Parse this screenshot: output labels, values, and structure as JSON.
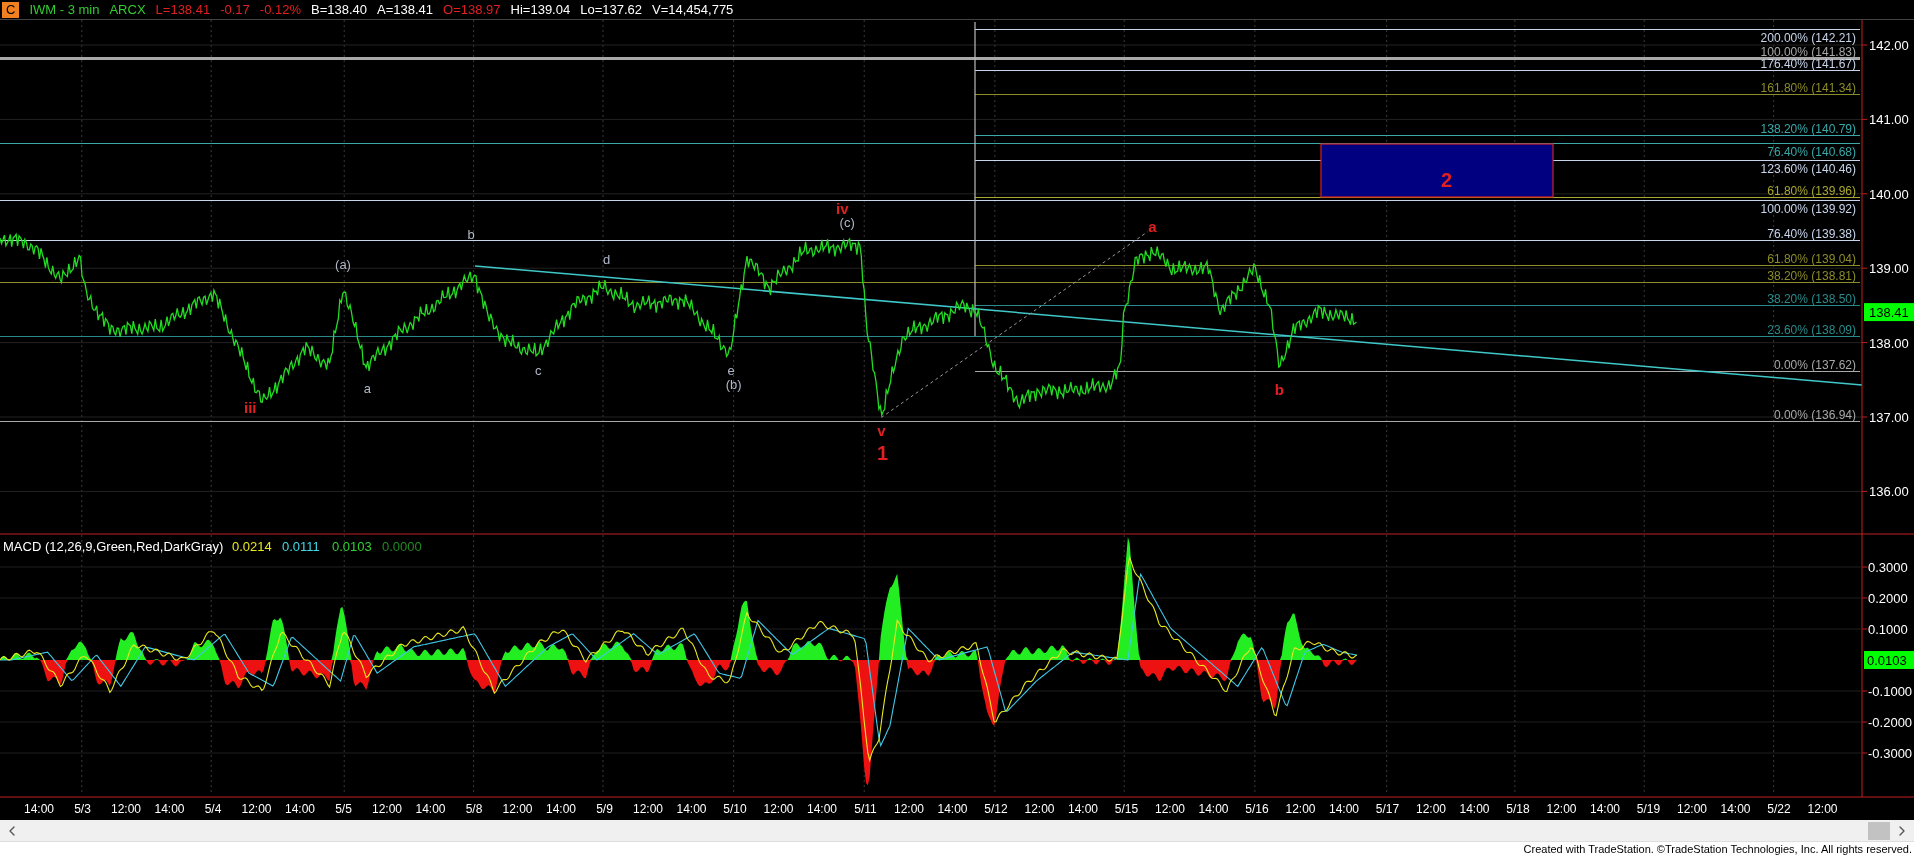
{
  "header": {
    "badge": "C",
    "items": [
      {
        "text": "IWM - 3 min",
        "color": "#33cc33"
      },
      {
        "text": "ARCX",
        "color": "#33cc33"
      },
      {
        "text": "L=138.41",
        "color": "#e02020"
      },
      {
        "text": "-0.17",
        "color": "#e02020"
      },
      {
        "text": "-0.12%",
        "color": "#e02020"
      },
      {
        "text": "B=138.40",
        "color": "#ffffff"
      },
      {
        "text": "A=138.41",
        "color": "#ffffff"
      },
      {
        "text": "O=138.97",
        "color": "#e02020"
      },
      {
        "text": "Hi=139.04",
        "color": "#ffffff"
      },
      {
        "text": "Lo=137.62",
        "color": "#ffffff"
      },
      {
        "text": "V=14,454,775",
        "color": "#ffffff"
      }
    ]
  },
  "price_axis": {
    "labels": [
      "142.00",
      "141.00",
      "140.00",
      "139.00",
      "138.00",
      "137.00",
      "136.00"
    ],
    "last_price": "138.41"
  },
  "fib_levels": [
    {
      "label": "200.00% (142.21)",
      "color": "#c8d4ea",
      "from_start": false
    },
    {
      "label": "100.00% (141.83)",
      "color": "#a8a8a8",
      "from_start": true
    },
    {
      "label": "176.40% (141.67)",
      "color": "#c8d4ea",
      "from_start": false
    },
    {
      "label": "161.80% (141.34)",
      "color": "#8c8c2a",
      "from_start": false
    },
    {
      "label": "138.20% (140.79)",
      "color": "#38a8a8",
      "from_start": false
    },
    {
      "label": "76.40% (140.68)",
      "color": "#38a8a8",
      "from_start": true
    },
    {
      "label": "123.60% (140.46)",
      "color": "#c8d4ea",
      "from_start": false
    },
    {
      "label": "61.80% (139.96)",
      "color": "#a8a830",
      "from_start": false
    },
    {
      "label": "100.00% (139.92)",
      "color": "#c8d4ea",
      "from_start": true
    },
    {
      "label": "76.40% (139.38)",
      "color": "#c8d4ea",
      "from_start": true
    },
    {
      "label": "61.80% (139.04)",
      "color": "#8c8c2a",
      "from_start": false
    },
    {
      "label": "38.20% (138.81)",
      "color": "#8c8c2a",
      "from_start": true
    },
    {
      "label": "38.20% (138.50)",
      "color": "#2a8a8a",
      "from_start": false
    },
    {
      "label": "23.60% (138.09)",
      "color": "#2a8a8a",
      "from_start": true
    },
    {
      "label": "0.00% (137.62)",
      "color": "#a8a8a8",
      "from_start": false
    },
    {
      "label": "0.00% (136.94)",
      "color": "#a8a8a8",
      "from_start": true
    }
  ],
  "wave_labels": [
    {
      "text": "iii",
      "color": "#e02020",
      "kind": "minor"
    },
    {
      "text": "(a)",
      "color": "#b0b8c8",
      "kind": "minor"
    },
    {
      "text": "a",
      "color": "#b0b8c8",
      "kind": "minor"
    },
    {
      "text": "b",
      "color": "#b0b8c8",
      "kind": "minor"
    },
    {
      "text": "c",
      "color": "#b0b8c8",
      "kind": "minor"
    },
    {
      "text": "d",
      "color": "#b0b8c8",
      "kind": "minor"
    },
    {
      "text": "e",
      "color": "#b0b8c8",
      "kind": "minor"
    },
    {
      "text": "(b)",
      "color": "#b0b8c8",
      "kind": "minor"
    },
    {
      "text": "iv",
      "color": "#e02020",
      "kind": "minor"
    },
    {
      "text": "(c)",
      "color": "#b0b8c8",
      "kind": "minor"
    },
    {
      "text": "v",
      "color": "#e02020",
      "kind": "minor"
    },
    {
      "text": "1",
      "color": "#e02020",
      "kind": "major"
    },
    {
      "text": "a",
      "color": "#e02020",
      "kind": "minor"
    },
    {
      "text": "b",
      "color": "#e02020",
      "kind": "minor"
    },
    {
      "text": "2",
      "color": "#e02020",
      "kind": "major"
    }
  ],
  "macd": {
    "title": "MACD (12,26,9,Green,Red,DarkGray)",
    "values": [
      {
        "text": "0.0214",
        "color": "#e8e820"
      },
      {
        "text": "0.0111",
        "color": "#40d8e8"
      },
      {
        "text": "0.0103",
        "color": "#30d030"
      },
      {
        "text": "0.0000",
        "color": "#208a20"
      }
    ],
    "axis_labels": [
      "0.3000",
      "0.2000",
      "0.1000",
      "-0.1000",
      "-0.2000",
      "-0.3000"
    ],
    "last_value": "0.0103"
  },
  "time_axis": [
    "14:00",
    "5/3",
    "12:00",
    "14:00",
    "5/4",
    "12:00",
    "14:00",
    "5/5",
    "12:00",
    "14:00",
    "5/8",
    "12:00",
    "14:00",
    "5/9",
    "12:00",
    "14:00",
    "5/10",
    "12:00",
    "14:00",
    "5/11",
    "12:00",
    "14:00",
    "5/12",
    "12:00",
    "14:00",
    "5/15",
    "12:00",
    "14:00",
    "5/16",
    "12:00",
    "14:00",
    "5/17",
    "12:00",
    "14:00",
    "5/18",
    "12:00",
    "14:00",
    "5/19",
    "12:00",
    "14:00",
    "5/22",
    "12:00"
  ],
  "footer": "Created with TradeStation. ©TradeStation Technologies, Inc. All rights reserved."
}
